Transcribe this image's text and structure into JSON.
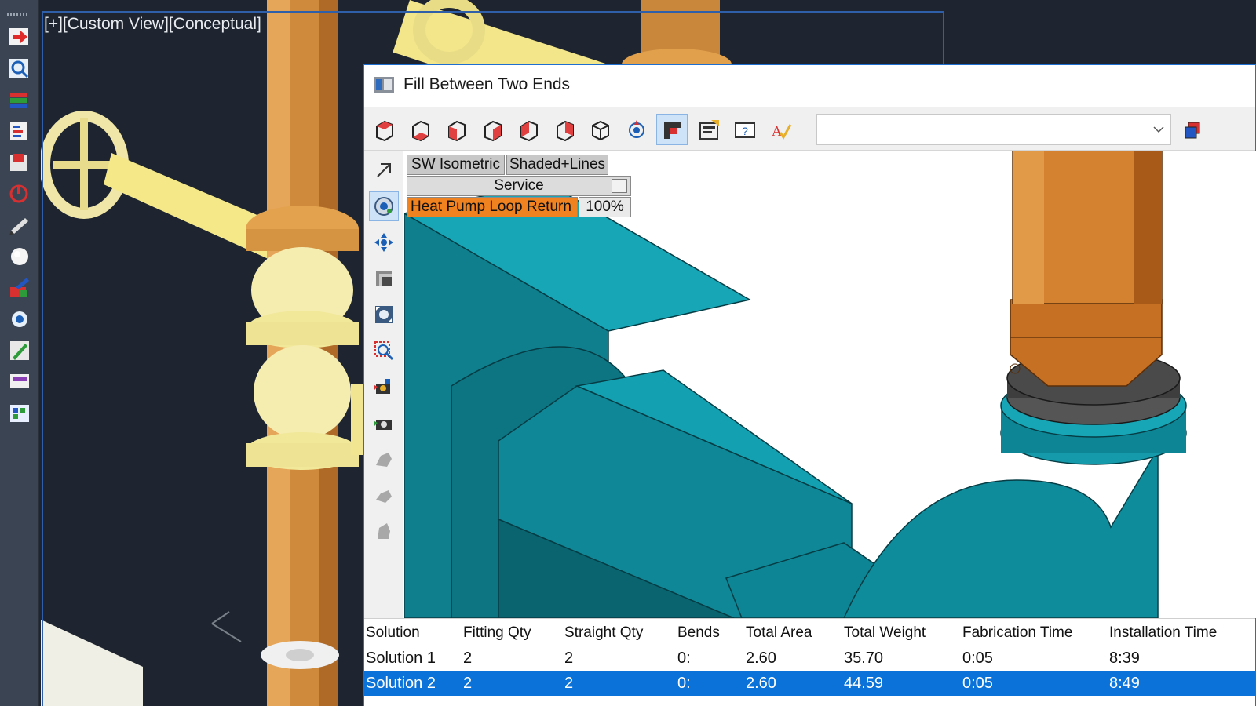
{
  "viewport": {
    "label": "[+][Custom View][Conceptual]"
  },
  "left_palette": {
    "tools": [
      "arrow-tool-icon",
      "zoom-tool-icon",
      "layers-tool-icon",
      "properties-tool-icon",
      "insert-tool-icon",
      "connector-tool-icon",
      "pencil-tool-icon",
      "sphere-tool-icon",
      "paint-tool-icon",
      "orbit-tool-icon",
      "edit-tool-icon",
      "view-tool-icon",
      "table-tool-icon"
    ]
  },
  "dialog": {
    "title": "Fill Between Two Ends",
    "toolbar": {
      "buttons": [
        "view-cube-top-icon",
        "view-cube-bottom-icon",
        "view-cube-left-icon",
        "view-cube-right-icon",
        "view-cube-front-icon",
        "view-cube-back-icon",
        "view-cube-iso-icon",
        "orbit-icon",
        "fill-ends-icon",
        "service-settings-icon",
        "help-icon",
        "spell-check-icon"
      ],
      "active_button": "fill-ends-icon",
      "scheme_select_value": "",
      "extra_button": "layers-stack-icon"
    },
    "sidebar": {
      "buttons": [
        "select-arrow-icon",
        "orbit-view-icon",
        "pan-icon",
        "shade-icon",
        "zoom-extents-icon",
        "zoom-window-icon",
        "camera-record-icon",
        "camera-icon",
        "part-gray-icon",
        "part-gray-2-icon",
        "part-gray-3-icon"
      ],
      "active_button": "orbit-view-icon"
    },
    "view_overlay": {
      "view_preset": "SW Isometric",
      "visual_style": "Shaded+Lines",
      "service_header": "Service",
      "service_value": "Heat Pump Loop Return",
      "opacity": "100%"
    },
    "solutions_table": {
      "columns": [
        "Solution",
        "Fitting Qty",
        "Straight Qty",
        "Bends",
        "Total Area",
        "Total Weight",
        "Fabrication Time",
        "Installation Time"
      ],
      "rows": [
        [
          "Solution 1",
          "2",
          "2",
          "0:",
          "2.60",
          "35.70",
          "0:05",
          "8:39"
        ],
        [
          "Solution 2",
          "2",
          "2",
          "0:",
          "2.60",
          "44.59",
          "0:05",
          "8:49"
        ]
      ],
      "selected_row": 1
    }
  },
  "colors": {
    "viewport_bg": "#1e2530",
    "pipe_yellow": "#f5e88a",
    "pipe_copper": "#d98c3a",
    "teal": "#0e8a99",
    "selection_blue": "#0a72d8",
    "service_orange": "#f0821f"
  }
}
